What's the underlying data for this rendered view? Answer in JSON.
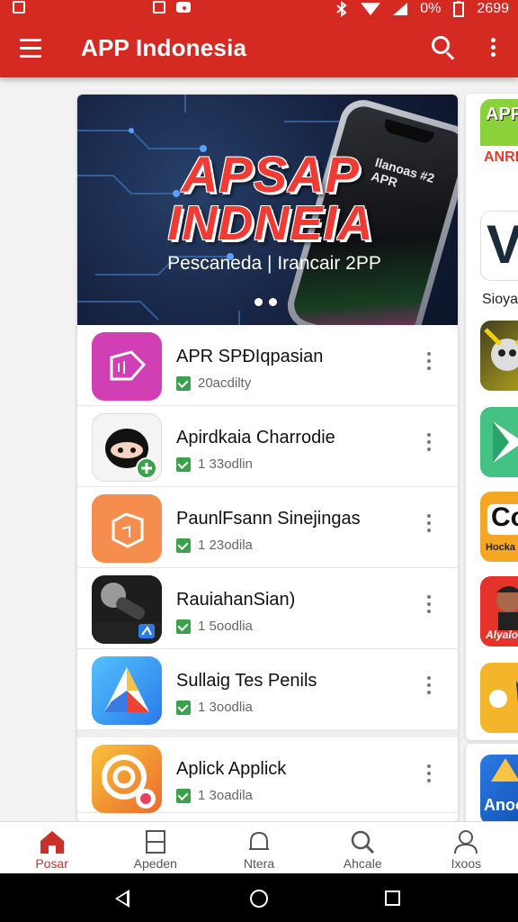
{
  "status_bar": {
    "battery_text": "0%",
    "time": "2699"
  },
  "app_bar": {
    "title": "APP Indonesia"
  },
  "banner": {
    "title_line1": "APSAP",
    "title_line2": "INDNEIA",
    "subtitle": "Pescaneda | Irancair 2PP",
    "phone_text_line1": "Ilanoas #2",
    "phone_text_line2": "APR"
  },
  "apps": [
    {
      "name": "APR SPĐIqpasian",
      "meta": "20acdilty",
      "icon": "pink-puzzle-icon",
      "color": "#d13fb5"
    },
    {
      "name": "Apirdkaia Charrodie",
      "meta": "1 33odlin",
      "icon": "ninja-mascot-icon",
      "color": "#ffffff"
    },
    {
      "name": "PaunlFsann Sinejingas",
      "meta": "1 23odila",
      "icon": "orange-box-icon",
      "color": "#f58d4e"
    },
    {
      "name": "RauiahanSian)",
      "meta": "1 5oodlia",
      "icon": "microphone-icon",
      "color": "#1d1d1d"
    },
    {
      "name": "Sullaig Tes Penils",
      "meta": "1 3oodlia",
      "icon": "triangle-logo-icon",
      "color": "#3aa7f0"
    },
    {
      "name": "Aplick Applick",
      "meta": "1 3oadila",
      "icon": "target-logo-icon",
      "color": "#f3a624"
    }
  ],
  "side_apps": {
    "tile1_text": "APP",
    "tile1_sub": "ANRI",
    "tile2_letter": "V",
    "tile2_label": "Sioya",
    "tile5_text": "Co",
    "tile5_sub": "Hocka D.",
    "tile6_sub": "Alyalo",
    "tile8_text": "Anoo"
  },
  "bottom_nav": [
    {
      "label": "Posar",
      "icon": "home-icon"
    },
    {
      "label": "Apeden",
      "icon": "apps-box-icon"
    },
    {
      "label": "Ntera",
      "icon": "bell-icon"
    },
    {
      "label": "Ahcale",
      "icon": "search-icon"
    },
    {
      "label": "Ixoos",
      "icon": "person-icon"
    }
  ]
}
